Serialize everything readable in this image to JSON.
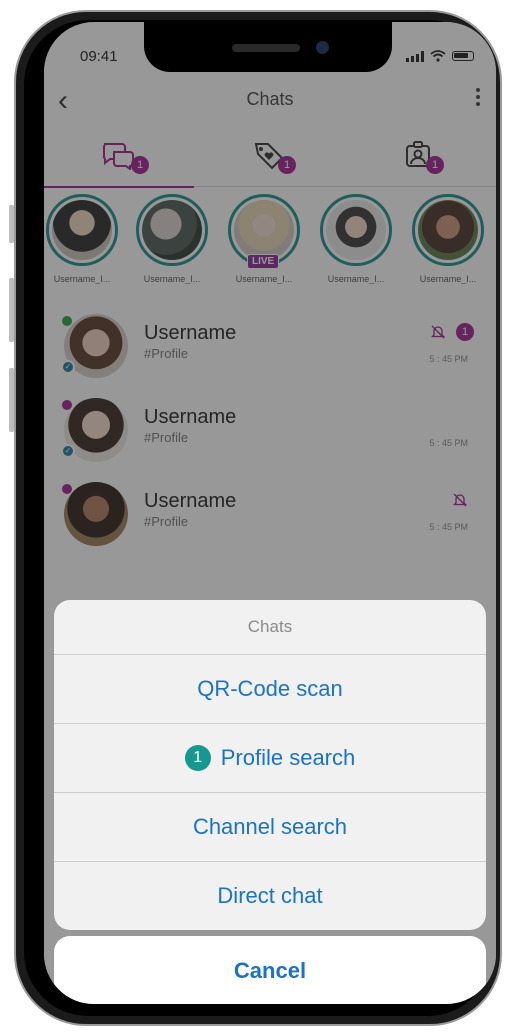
{
  "status_bar": {
    "time": "09:41"
  },
  "header": {
    "title": "Chats"
  },
  "tabs": [
    {
      "icon": "chat-bubbles-icon",
      "badge": "1",
      "active": true
    },
    {
      "icon": "tag-heart-icon",
      "badge": "1",
      "active": false
    },
    {
      "icon": "contact-icon",
      "badge": "1",
      "active": false
    }
  ],
  "stories": [
    {
      "name": "Username_I...",
      "live": false
    },
    {
      "name": "Username_I...",
      "live": false
    },
    {
      "name": "Username_I...",
      "live": true,
      "live_label": "LIVE"
    },
    {
      "name": "Username_I...",
      "live": false
    },
    {
      "name": "Username_I...",
      "live": false
    }
  ],
  "chats": [
    {
      "username": "Username",
      "handle": "#Profile",
      "time": "5 : 45 PM",
      "muted": true,
      "badge": "1"
    },
    {
      "username": "Username",
      "handle": "#Profile",
      "time": "5 : 45 PM",
      "muted": false
    },
    {
      "username": "Username",
      "handle": "#Profile",
      "time": "5 : 45 PM",
      "muted": true
    }
  ],
  "action_sheet": {
    "title": "Chats",
    "items": [
      {
        "label": "QR-Code scan"
      },
      {
        "label": "Profile search",
        "step": "1"
      },
      {
        "label": "Channel search"
      },
      {
        "label": "Direct chat"
      }
    ],
    "cancel": "Cancel"
  },
  "colors": {
    "accent": "#a0208e",
    "teal": "#19918a",
    "ios_blue": "#1a73c8"
  }
}
